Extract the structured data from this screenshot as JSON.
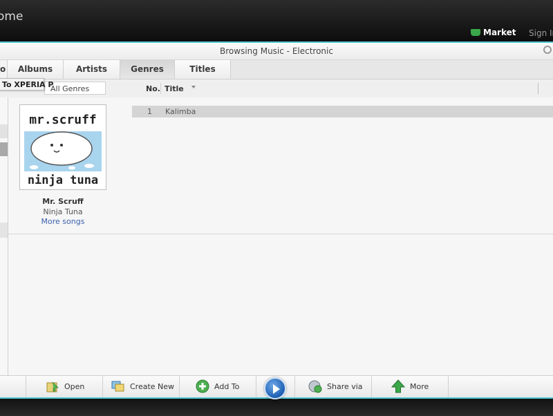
{
  "app": {
    "title": "ome"
  },
  "topbar": {
    "market_label": "Market",
    "signin_label": "Sign In"
  },
  "window": {
    "title": "Browsing Music - Electronic"
  },
  "tabs": {
    "partial_label": "o",
    "items": [
      {
        "label": "Albums"
      },
      {
        "label": "Artists"
      },
      {
        "label": "Genres"
      },
      {
        "label": "Titles"
      }
    ],
    "active": "Genres"
  },
  "tooltip": {
    "text": "To XPERIA P"
  },
  "filter": {
    "genre_value": "All Genres"
  },
  "columns": {
    "no": "No.",
    "title": "Title"
  },
  "album": {
    "artist": "Mr. Scruff",
    "name": "Ninja Tuna",
    "more_link": "More songs",
    "art_top_text": "mr.scruff",
    "art_bottom_text": "ninja tuna"
  },
  "tracks": [
    {
      "no": "1",
      "title": "Kalimba"
    }
  ],
  "bottombar": {
    "open_label": "Open",
    "create_label": "Create New",
    "add_label": "Add To",
    "share_label": "Share via",
    "more_label": "More"
  },
  "colors": {
    "accent": "#4fc6cf",
    "link": "#3b5fb0",
    "market_green": "#3aa84a"
  }
}
